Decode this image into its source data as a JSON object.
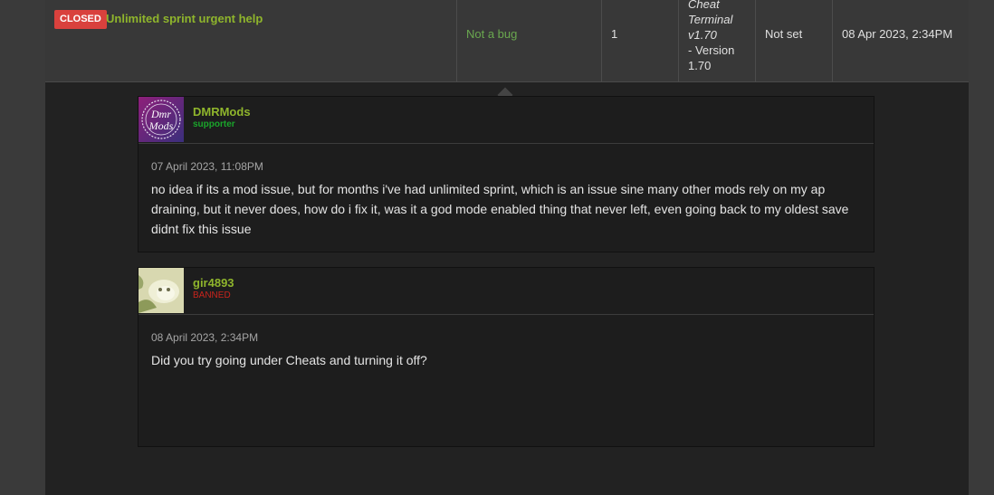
{
  "issue": {
    "badge": "CLOSED",
    "title": "Unlimited sprint urgent help",
    "status": "Not a bug",
    "count": "1",
    "version_mod_lines": [
      "Cheat",
      "Terminal",
      "v1.70"
    ],
    "version_line1": "- Version",
    "version_line2": "1.70",
    "priority": "Not set",
    "date": "08 Apr 2023, 2:34PM"
  },
  "comments": [
    {
      "username": "DMRMods",
      "role": "supporter",
      "date": "07 April 2023, 11:08PM",
      "text": "no idea if its a mod issue, but for months i've had unlimited sprint, which is an issue sine many other mods rely on my ap draining, but it never does, how do i fix it, was it a god mode enabled thing that never left, even going back to my oldest save didnt fix this issue"
    },
    {
      "username": "gir4893",
      "role": "BANNED",
      "date": "08 April 2023, 2:34PM",
      "text": "Did you try going under Cheats and turning it off?"
    }
  ],
  "avatar_logo_text": [
    "Dmr",
    "Mods"
  ],
  "colors": {
    "accent_green": "#8fb52c",
    "closed_red": "#d9413d",
    "supporter_green": "#1aa52b",
    "banned_red": "#c8241d"
  }
}
